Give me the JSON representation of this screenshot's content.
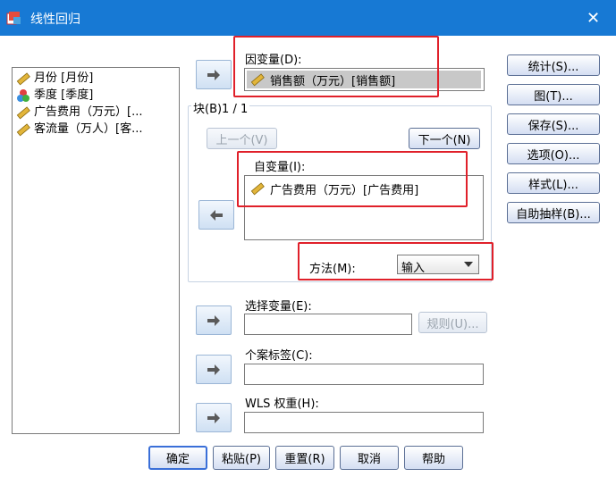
{
  "window": {
    "title": "线性回归",
    "close": "✕"
  },
  "variables": [
    {
      "label": "月份 [月份]",
      "icon": "ruler-icon"
    },
    {
      "label": "季度 [季度]",
      "icon": "nominal-icon"
    },
    {
      "label": "广告费用（万元）[...",
      "icon": "ruler-icon"
    },
    {
      "label": "客流量（万人）[客...",
      "icon": "ruler-icon"
    }
  ],
  "dependent": {
    "label": "因变量(D):",
    "value": "销售额（万元）[销售额]"
  },
  "block": {
    "label": "块(B)1 / 1",
    "prev": "上一个(V)",
    "next": "下一个(N)"
  },
  "independent": {
    "label": "自变量(I):",
    "value": "广告费用（万元）[广告费用]"
  },
  "method": {
    "label": "方法(M):",
    "value": "输入"
  },
  "selection": {
    "label": "选择变量(E):",
    "rule": "规则(U)..."
  },
  "case_label": {
    "label": "个案标签(C):"
  },
  "wls": {
    "label": "WLS 权重(H):"
  },
  "side_buttons": [
    "统计(S)...",
    "图(T)...",
    "保存(S)...",
    "选项(O)...",
    "样式(L)...",
    "自助抽样(B)..."
  ],
  "bottom_buttons": [
    "确定",
    "粘贴(P)",
    "重置(R)",
    "取消",
    "帮助"
  ],
  "colors": {
    "titlebar": "#1779d4",
    "highlight": "#e0202a",
    "selected_row": "#c8c8c8"
  }
}
